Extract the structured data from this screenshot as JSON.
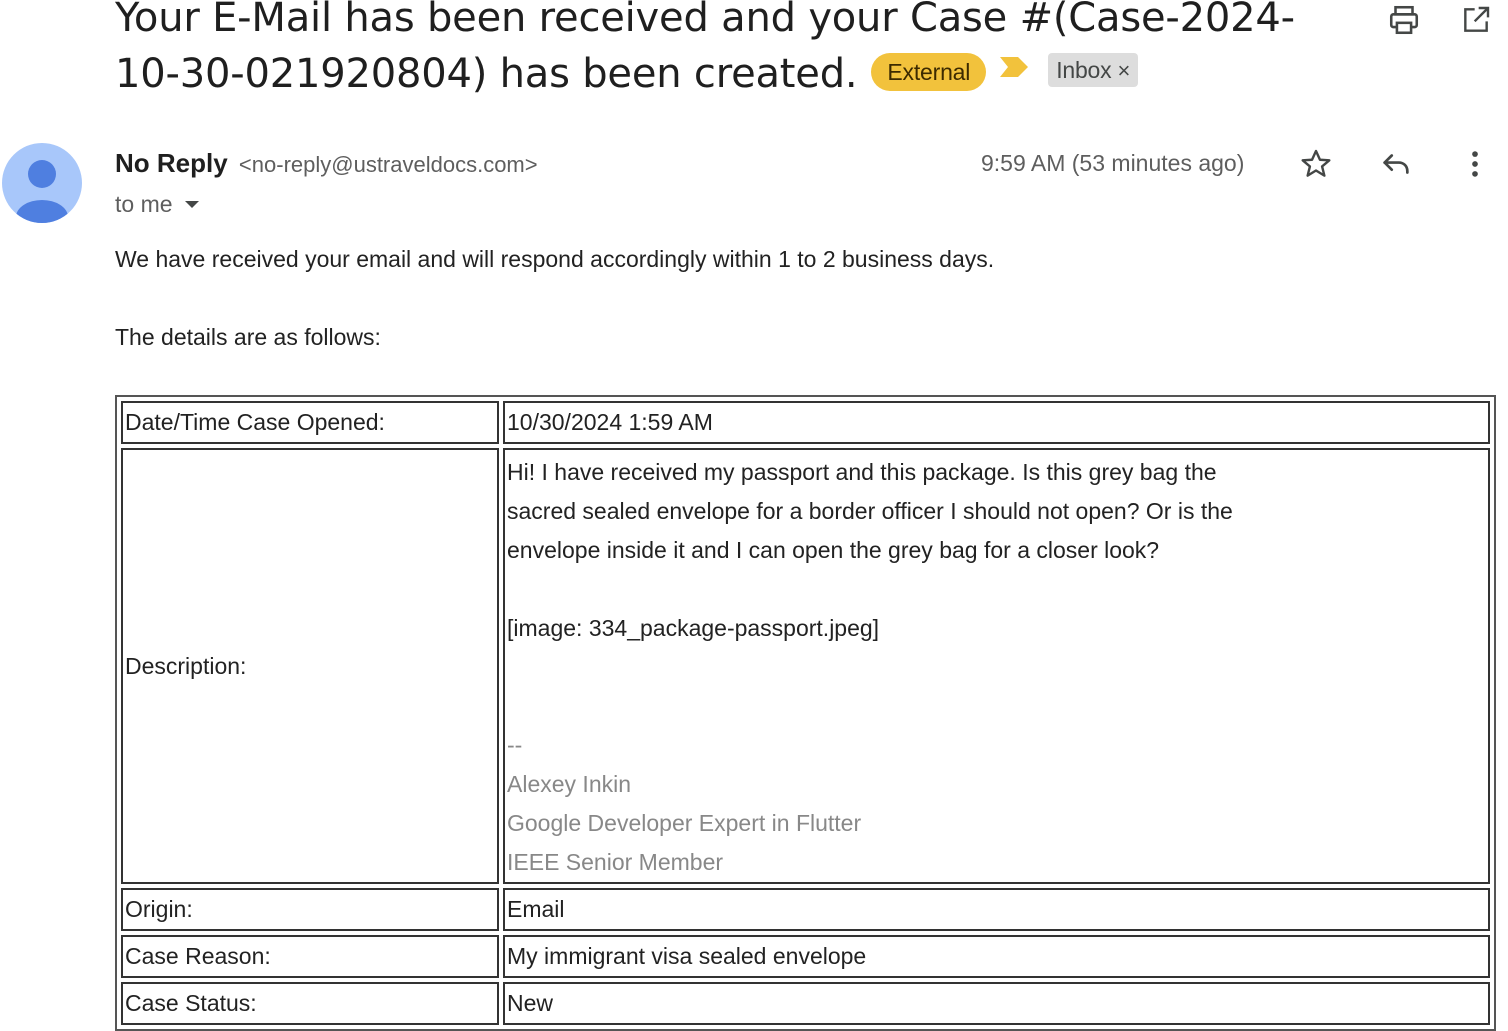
{
  "subject": {
    "text": "Your E-Mail has been received and your Case #(Case-2024-10-30-021920804) has been created.",
    "labels": {
      "external": "External",
      "inbox": "Inbox",
      "inbox_remove": "×"
    }
  },
  "toolbar": {
    "print_icon": "printer-icon",
    "popout_icon": "open-in-new-window-icon"
  },
  "message": {
    "sender_name": "No Reply",
    "sender_email": "<no-reply@ustraveldocs.com>",
    "recipient": "to me",
    "time": "9:59 AM (53 minutes ago)",
    "icons": [
      "star-icon",
      "reply-icon",
      "more-vertical-icon"
    ]
  },
  "body": {
    "intro": "We have received your email and will respond accordingly within 1 to 2 business days.",
    "details_heading": "The details are as follows:"
  },
  "details_table": {
    "rows": [
      {
        "key": "Date/Time Case Opened:",
        "value": "10/30/2024 1:59 AM"
      },
      {
        "key": "Description:"
      },
      {
        "key": "Origin:",
        "value": "Email"
      },
      {
        "key": "Case Reason:",
        "value": "My immigrant visa sealed envelope"
      },
      {
        "key": "Case Status:",
        "value": "New"
      }
    ],
    "description": {
      "lines": [
        "Hi! I have received my passport and this package. Is this grey bag the",
        "sacred sealed envelope for a border officer I should not open? Or is the",
        "envelope inside it and I can open the grey bag for a closer look?",
        "",
        "[image: 334_package-passport.jpeg]",
        "",
        ""
      ],
      "signature": [
        "--",
        "Alexey Inkin",
        "Google Developer Expert in Flutter",
        "IEEE Senior Member"
      ]
    }
  },
  "colors": {
    "external_label": "#f2c23c",
    "importance_marker": "#f2c23c",
    "inbox_label": "#dddddd",
    "avatar_bg": "#a8c7fa",
    "avatar_fg": "#4f7fe0",
    "signature_text": "#888888"
  }
}
